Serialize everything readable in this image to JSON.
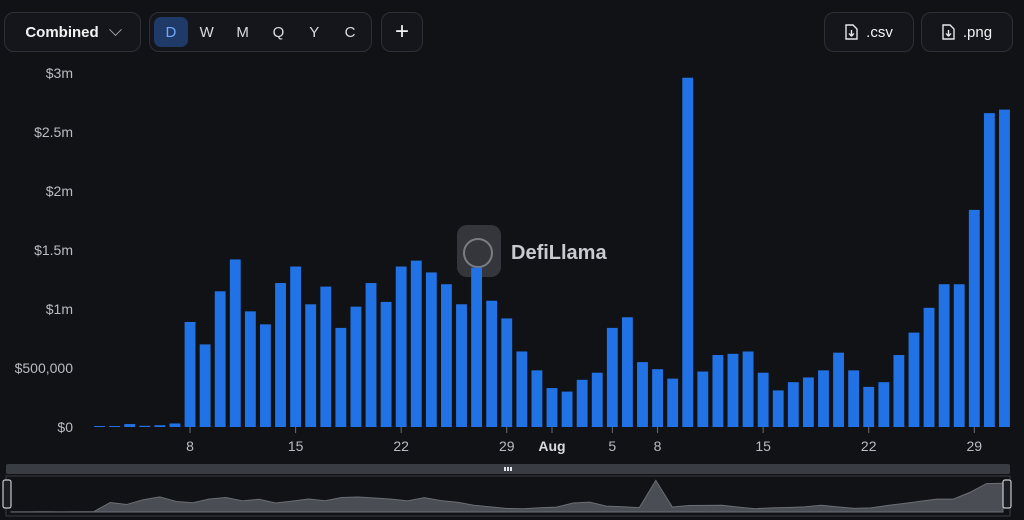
{
  "toolbar": {
    "view_label": "Combined",
    "periods": [
      "D",
      "W",
      "M",
      "Q",
      "Y",
      "C"
    ],
    "active_period": "D",
    "add_label": "+",
    "csv_label": ".csv",
    "png_label": ".png"
  },
  "watermark": "DefiLlama",
  "colors": {
    "bar": "#2172e5",
    "background": "#111216",
    "navigator_fill": "#4b4d55"
  },
  "chart_data": {
    "type": "bar",
    "title": "",
    "xlabel": "",
    "ylabel": "",
    "ylim": [
      0,
      3000000
    ],
    "yticks": [
      {
        "value": 0,
        "label": "$0"
      },
      {
        "value": 500000,
        "label": "$500,000"
      },
      {
        "value": 1000000,
        "label": "$1m"
      },
      {
        "value": 1500000,
        "label": "$1.5m"
      },
      {
        "value": 2000000,
        "label": "$2m"
      },
      {
        "value": 2500000,
        "label": "$2.5m"
      },
      {
        "value": 3000000,
        "label": "$3m"
      }
    ],
    "xticks": [
      {
        "index": 6,
        "label": "8",
        "bold": false
      },
      {
        "index": 13,
        "label": "15",
        "bold": false
      },
      {
        "index": 20,
        "label": "22",
        "bold": false
      },
      {
        "index": 27,
        "label": "29",
        "bold": false
      },
      {
        "index": 30,
        "label": "Aug",
        "bold": true
      },
      {
        "index": 34,
        "label": "5",
        "bold": false
      },
      {
        "index": 37,
        "label": "8",
        "bold": false
      },
      {
        "index": 44,
        "label": "15",
        "bold": false
      },
      {
        "index": 51,
        "label": "22",
        "bold": false
      },
      {
        "index": 58,
        "label": "29",
        "bold": false
      }
    ],
    "values": [
      5000,
      5000,
      25000,
      10000,
      15000,
      30000,
      890000,
      700000,
      1150000,
      1420000,
      980000,
      870000,
      1220000,
      1360000,
      1040000,
      1190000,
      840000,
      1020000,
      1220000,
      1060000,
      1360000,
      1410000,
      1310000,
      1210000,
      1040000,
      1350000,
      1070000,
      920000,
      640000,
      480000,
      330000,
      300000,
      400000,
      460000,
      840000,
      930000,
      550000,
      490000,
      410000,
      2960000,
      470000,
      610000,
      620000,
      640000,
      460000,
      310000,
      380000,
      420000,
      480000,
      630000,
      480000,
      340000,
      380000,
      610000,
      800000,
      1010000,
      1210000,
      1210000,
      1840000,
      2660000,
      2690000
    ]
  }
}
